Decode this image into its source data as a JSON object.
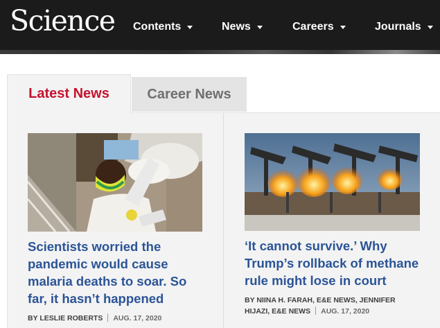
{
  "header": {
    "logo": "Science",
    "nav": [
      {
        "label": "Contents"
      },
      {
        "label": "News"
      },
      {
        "label": "Careers"
      },
      {
        "label": "Journals"
      }
    ]
  },
  "tabs": {
    "active": "Latest News",
    "inactive": "Career News"
  },
  "articles": [
    {
      "headline": "Scientists worried the pandemic would cause malaria deaths to soar. So far, it hasn’t happened",
      "author": "BY LESLIE ROBERTS",
      "date": "AUG. 17, 2020"
    },
    {
      "headline": "‘It cannot survive.’ Why Trump’s rollback of methane rule might lose in court",
      "author": "BY NIINA H. FARAH, E&E NEWS, JENNIFER HIJAZI, E&E NEWS",
      "date": "AUG. 17, 2020"
    }
  ]
}
